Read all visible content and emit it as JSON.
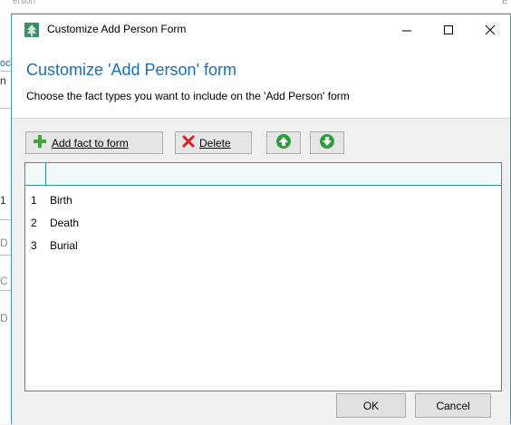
{
  "background_app": {
    "top_text": "erson",
    "top_right_text": "E",
    "edge_chars": [
      "oc",
      "n",
      "1",
      "D",
      "C",
      "D"
    ]
  },
  "dialog": {
    "title": "Customize Add Person Form",
    "window_controls": [
      "minimize",
      "maximize",
      "close"
    ],
    "heading": "Customize 'Add Person' form",
    "description": "Choose the fact types you want to include on the 'Add Person' form",
    "toolbar": {
      "add_label": "Add fact to form",
      "delete_label": "Delete",
      "move_up_icon": "arrow-up-green-circle",
      "move_down_icon": "arrow-down-green-circle"
    },
    "grid": {
      "rows": [
        {
          "num": "1",
          "name": "Birth"
        },
        {
          "num": "2",
          "name": "Death"
        },
        {
          "num": "3",
          "name": "Burial"
        }
      ]
    },
    "ok_label": "OK",
    "cancel_label": "Cancel"
  },
  "colors": {
    "heading": "#1a6fb5",
    "grid_header": "#f1f9fa",
    "grid_header_border": "#3b8e9b",
    "add_icon": "#3aa93a",
    "delete_icon": "#d42020",
    "arrow_icon": "#2e9e3a"
  }
}
